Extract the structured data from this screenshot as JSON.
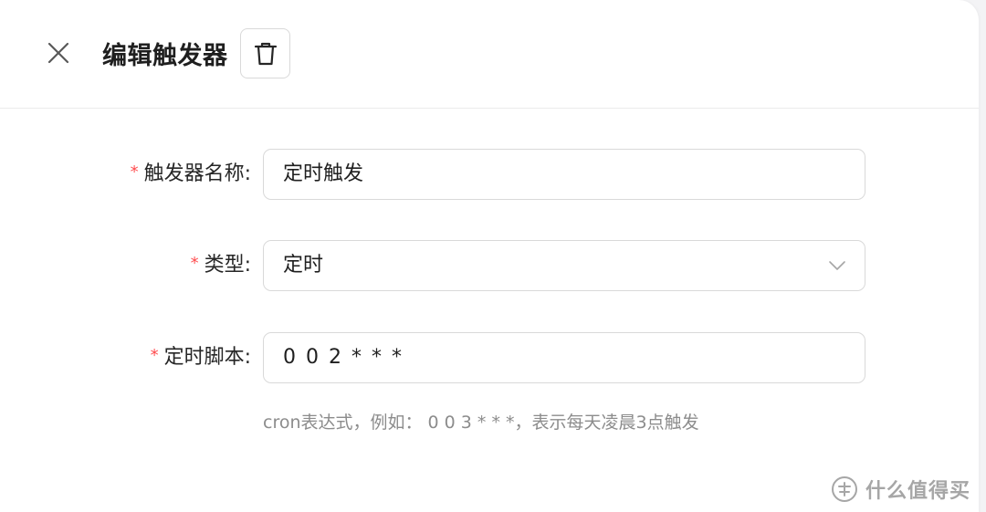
{
  "header": {
    "title": "编辑触发器",
    "close_icon": "close-icon",
    "delete_icon": "trash-icon"
  },
  "form": {
    "name": {
      "required_mark": "*",
      "label": "触发器名称:",
      "value": "定时触发"
    },
    "type": {
      "required_mark": "*",
      "label": "类型:",
      "value": "定时",
      "icon": "chevron-down-icon"
    },
    "script": {
      "required_mark": "*",
      "label": "定时脚本:",
      "value": "0 0 2 * * *"
    },
    "help_text": "cron表达式，例如： 0 0 3 * * *，表示每天凌晨3点触发"
  },
  "watermark": {
    "text": "什么值得买"
  },
  "colors": {
    "required": "#ff4d4f",
    "border": "#d9d9d9",
    "help_text": "#8c8c8c"
  }
}
